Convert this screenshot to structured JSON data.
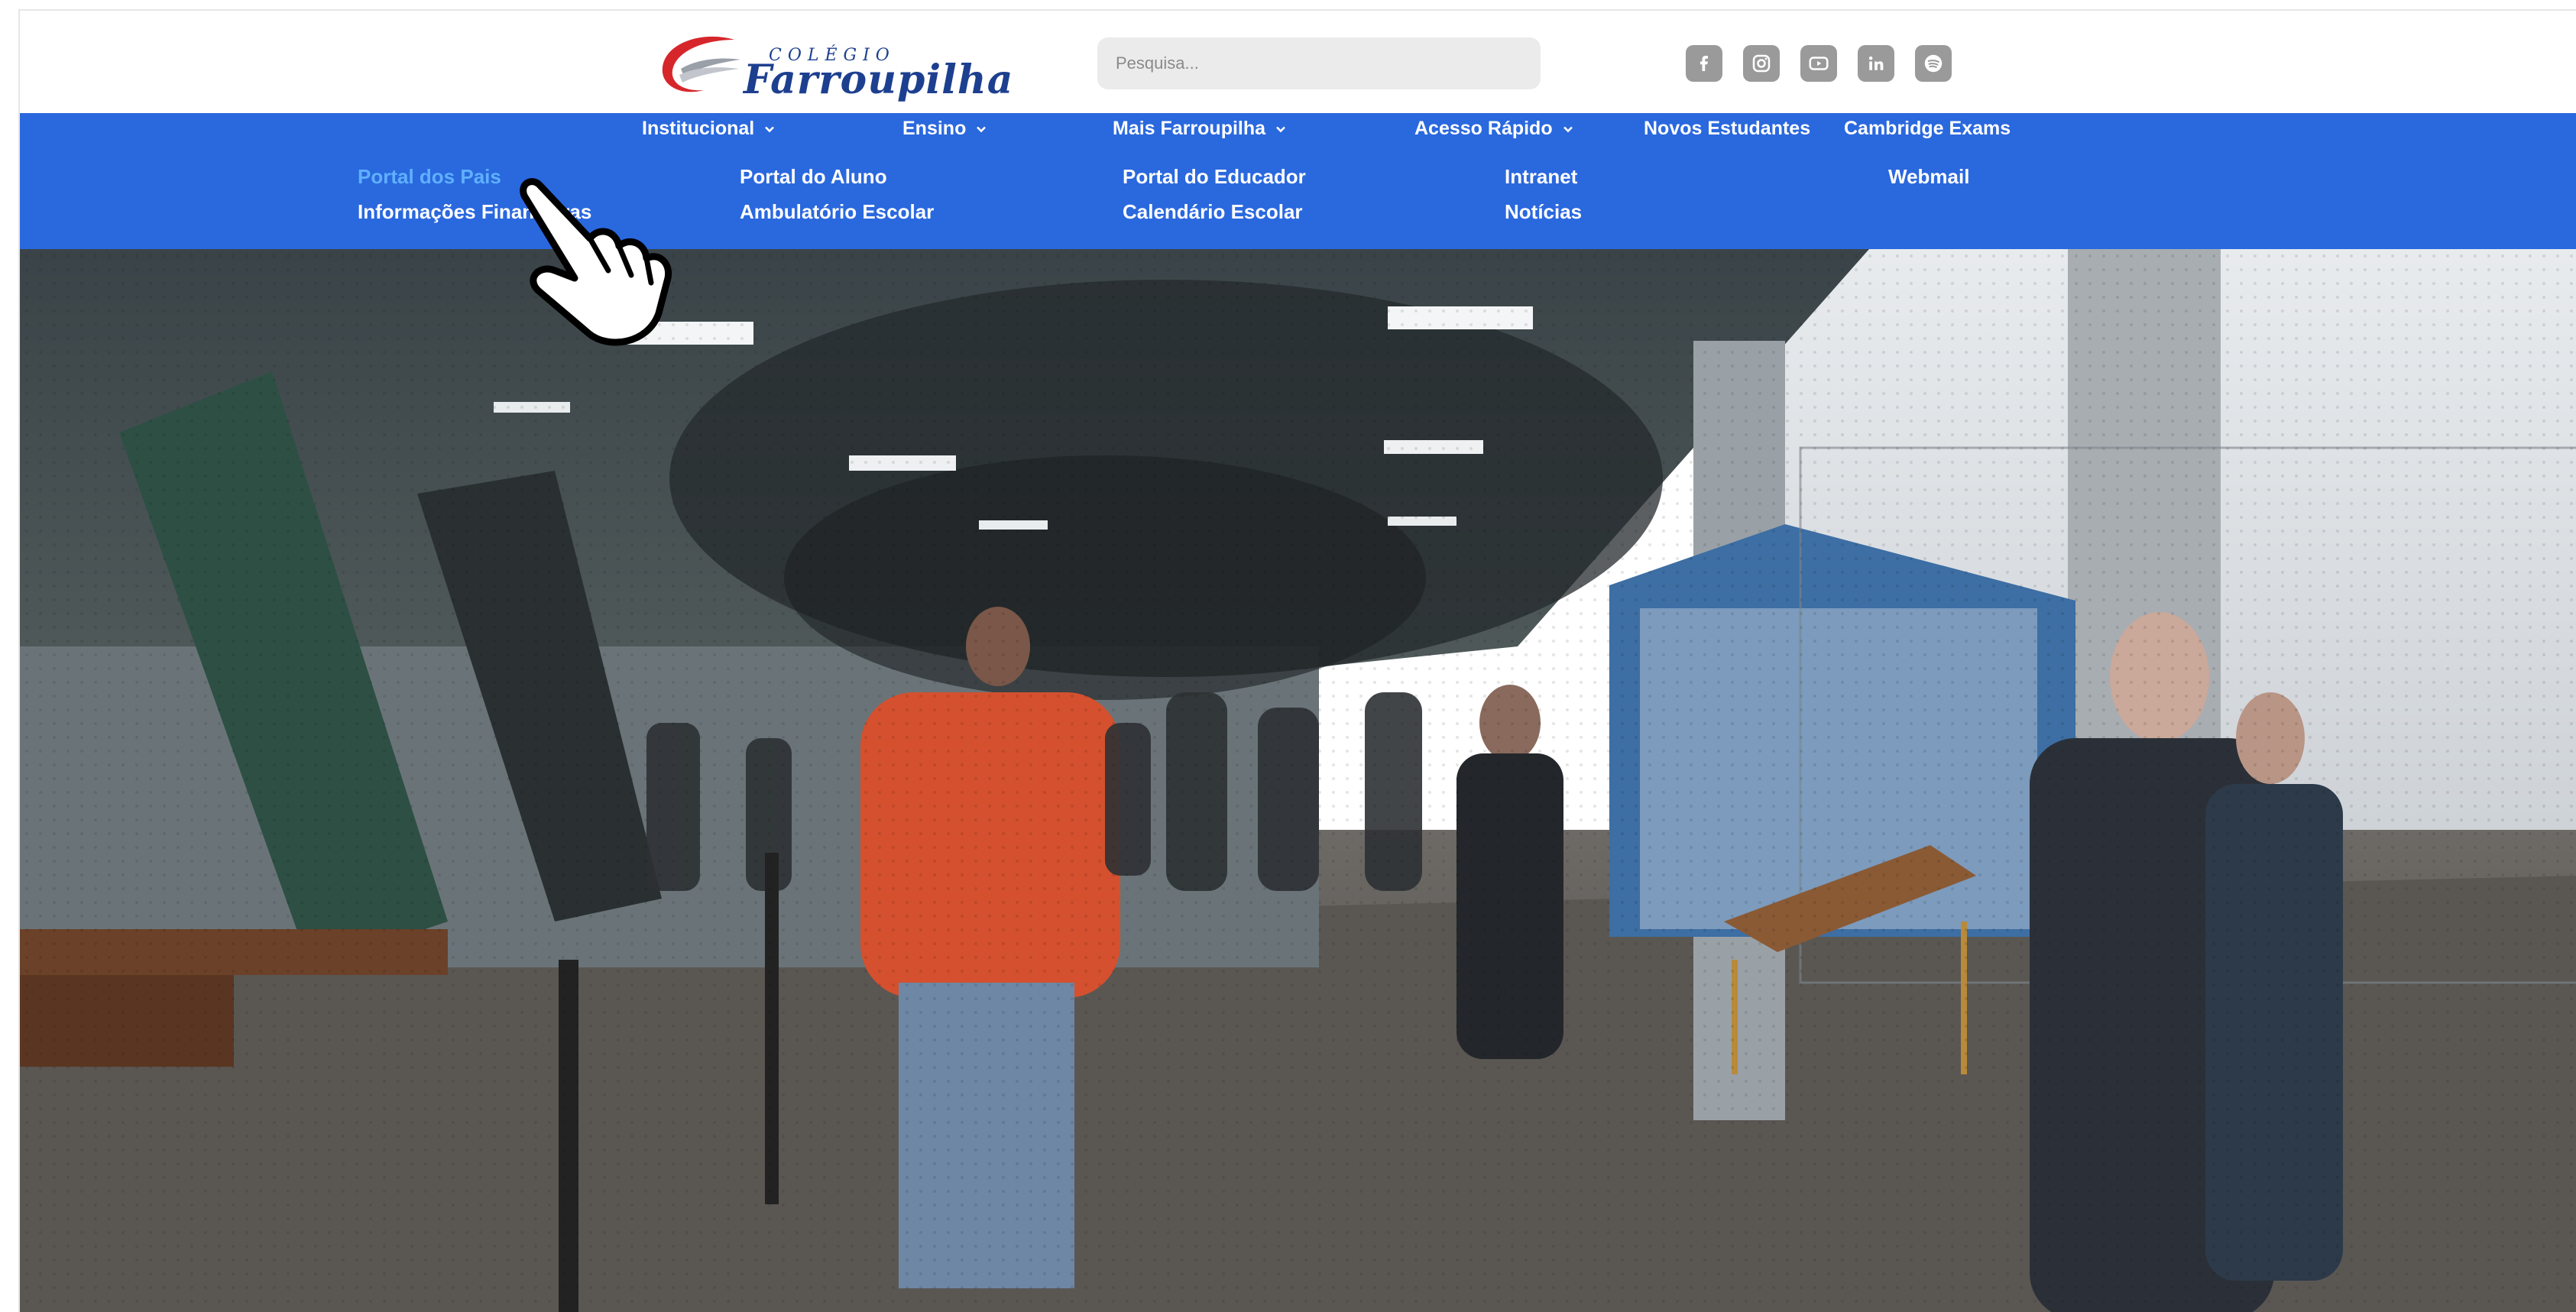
{
  "header": {
    "logo_small": "COLÉGIO",
    "logo_big": "Farroupilha",
    "search": {
      "placeholder": "Pesquisa..."
    },
    "social_icons": [
      "facebook-icon",
      "instagram-icon",
      "youtube-icon",
      "linkedin-icon",
      "spotify-icon"
    ]
  },
  "nav": {
    "items": [
      {
        "label": "Institucional",
        "has_dropdown": true
      },
      {
        "label": "Ensino",
        "has_dropdown": true
      },
      {
        "label": "Mais Farroupilha",
        "has_dropdown": true
      },
      {
        "label": "Acesso Rápido",
        "has_dropdown": true
      },
      {
        "label": "Novos Estudantes",
        "has_dropdown": false
      },
      {
        "label": "Cambridge Exams",
        "has_dropdown": false
      }
    ]
  },
  "dropdown": {
    "items": [
      {
        "label": "Portal dos Pais",
        "active": true
      },
      {
        "label": "Informações Financeiras"
      },
      {
        "label": "Portal do Aluno"
      },
      {
        "label": "Ambulatório Escolar"
      },
      {
        "label": "Portal do Educador"
      },
      {
        "label": "Calendário Escolar"
      },
      {
        "label": "Intranet"
      },
      {
        "label": "Notícias"
      },
      {
        "label": "Webmail"
      }
    ]
  },
  "colors": {
    "nav_blue": "#2a68de",
    "active_link": "#5fb0ff",
    "logo_blue": "#1d3f8f",
    "logo_red": "#d6262b"
  }
}
